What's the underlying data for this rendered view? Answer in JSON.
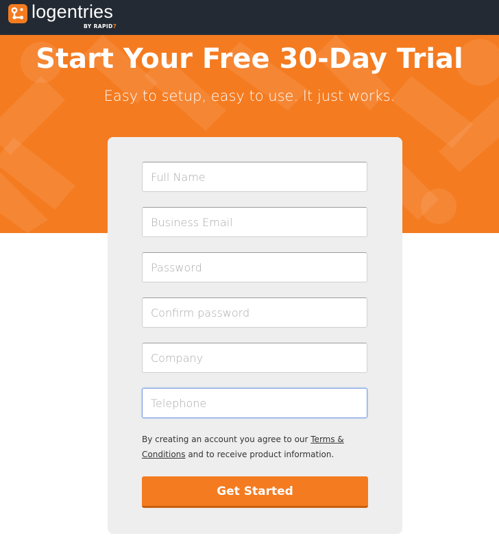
{
  "brand": {
    "name": "logentries",
    "byline_prefix": "BY",
    "byline_brand": "RAPID",
    "byline_mark": "7",
    "icon": "logentries-logo-icon",
    "colors": {
      "accent": "#f47b20",
      "topbar": "#232a33",
      "card": "#eeeeee"
    }
  },
  "hero": {
    "title": "Start Your Free 30-Day Trial",
    "subtitle": "Easy to setup, easy to use. It just works."
  },
  "form": {
    "fields": {
      "full_name": {
        "placeholder": "Full Name",
        "value": ""
      },
      "business_email": {
        "placeholder": "Business Email",
        "value": ""
      },
      "password": {
        "placeholder": "Password",
        "value": ""
      },
      "confirm_password": {
        "placeholder": "Confirm password",
        "value": ""
      },
      "company": {
        "placeholder": "Company",
        "value": ""
      },
      "telephone": {
        "placeholder": "Telephone",
        "value": ""
      }
    },
    "consent": {
      "prefix": "By creating an account you agree to our ",
      "link_line1": "Terms &",
      "link_line2": "Conditions",
      "suffix": " and to receive product information."
    },
    "submit_label": "Get Started"
  }
}
